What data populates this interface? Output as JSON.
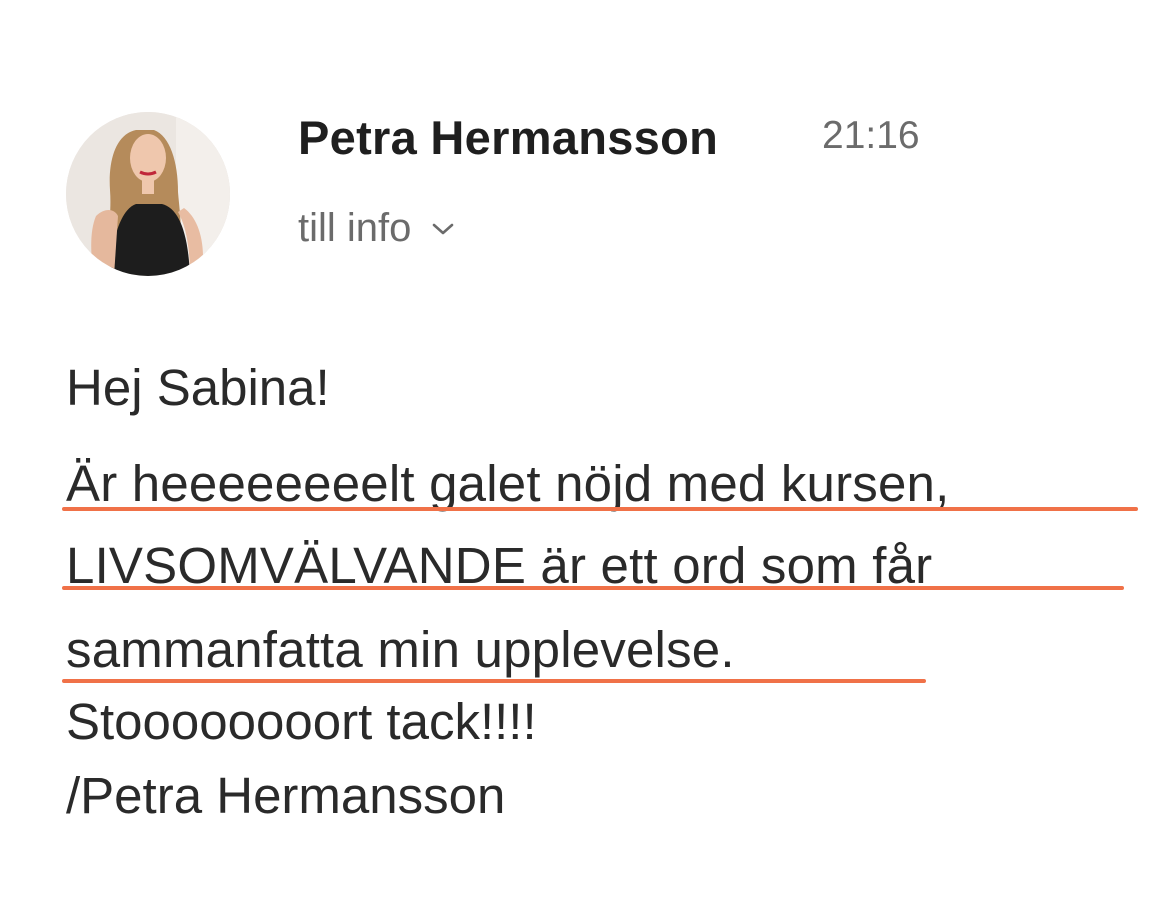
{
  "sender": {
    "name": "Petra Hermansson",
    "time": "21:16",
    "recipient": "till info"
  },
  "message": {
    "greeting": "Hej Sabina!",
    "lines": [
      "Är heeeeeeeelt galet nöjd med kursen,",
      "LIVSOMVÄLVANDE är ett ord som får",
      "sammanfatta min upplevelse.",
      "Stoooooooort tack!!!!",
      "/Petra Hermansson"
    ]
  },
  "colors": {
    "underline": "#f07148",
    "secondary_text": "#6b6b6b"
  },
  "icons": {
    "recipient_toggle": "chevron-down-icon"
  }
}
